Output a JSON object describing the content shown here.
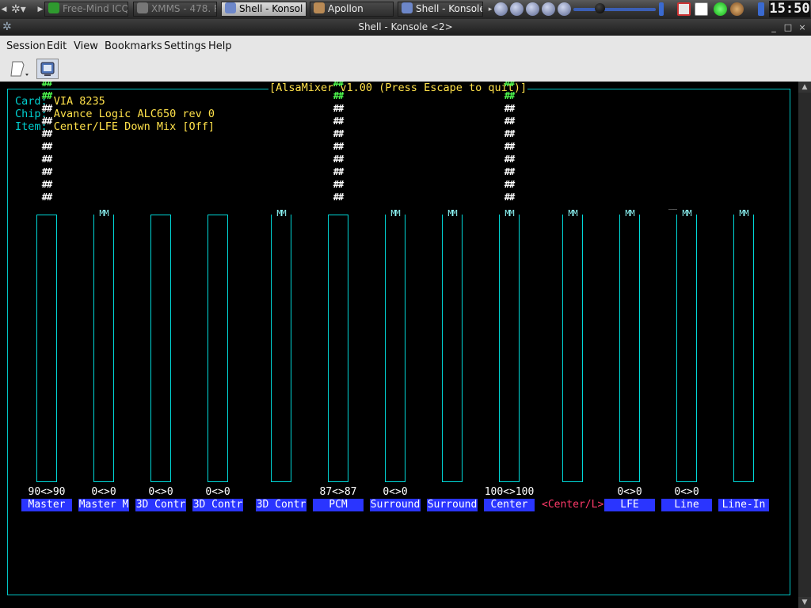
{
  "taskbar": {
    "tasks": [
      {
        "label": "Free-Mind ICQ",
        "icon": "flower-icon"
      },
      {
        "label": "XMMS - 478. R",
        "icon": "headphones-icon"
      },
      {
        "label": "Shell - Konsol",
        "icon": "star-icon"
      },
      {
        "label": "Apollon",
        "icon": "apollon-icon"
      },
      {
        "label": "Shell - Konsole",
        "icon": "star-icon"
      }
    ],
    "clock": "15:50"
  },
  "window": {
    "title": "Shell - Konsole <2>",
    "buttons": {
      "minimize": "_",
      "maximize": "□",
      "close": "×"
    }
  },
  "menubar": [
    "Session",
    "Edit",
    "View",
    "Bookmarks",
    "Settings",
    "Help"
  ],
  "terminal": {
    "frame_title": "[AlsaMixer v1.00 (Press Escape to quit)]",
    "info": [
      {
        "key": "Card:",
        "value": "VIA 8235"
      },
      {
        "key": "Chip:",
        "value": "Avance Logic ALC650 rev 0"
      },
      {
        "key": "Item:",
        "value": "Center/LFE Down Mix [Off]"
      }
    ],
    "cap_line": "______",
    "mm_label": "MM",
    "controls": [
      {
        "name": "Master",
        "value": "90<>90",
        "level": 18,
        "red": 2,
        "green": 8,
        "muted": false,
        "selected": false
      },
      {
        "name": "Master M",
        "value": "0<>0",
        "level": 0,
        "red": 0,
        "green": 0,
        "muted": true,
        "selected": false
      },
      {
        "name": "3D Contr",
        "value": "0<>0",
        "level": 0,
        "red": 0,
        "green": 0,
        "muted": false,
        "selected": false
      },
      {
        "name": "3D Contr",
        "value": "0<>0",
        "level": 0,
        "red": 0,
        "green": 0,
        "muted": false,
        "selected": false
      },
      {
        "name": "3D Contr",
        "value": "",
        "level": 0,
        "red": 0,
        "green": 0,
        "muted": true,
        "selected": false
      },
      {
        "name": "PCM",
        "value": "87<>87",
        "level": 18,
        "red": 2,
        "green": 8,
        "muted": false,
        "selected": false
      },
      {
        "name": "Surround",
        "value": "0<>0",
        "level": 0,
        "red": 0,
        "green": 0,
        "muted": true,
        "selected": false
      },
      {
        "name": "Surround",
        "value": "",
        "level": 0,
        "red": 0,
        "green": 0,
        "muted": true,
        "selected": false
      },
      {
        "name": "Center",
        "value": "100<>100",
        "level": 20,
        "red": 4,
        "green": 8,
        "muted": true,
        "selected": false
      },
      {
        "name": "<Center/L>",
        "value": "",
        "level": 0,
        "red": 0,
        "green": 0,
        "muted": true,
        "selected": true
      },
      {
        "name": "LFE",
        "value": "0<>0",
        "level": 0,
        "red": 0,
        "green": 0,
        "muted": true,
        "selected": false
      },
      {
        "name": "Line",
        "value": "0<>0",
        "level": 0,
        "red": 0,
        "green": 0,
        "muted": true,
        "selected": false
      },
      {
        "name": "Line-In",
        "value": "",
        "level": 0,
        "red": 0,
        "green": 0,
        "muted": true,
        "selected": false
      }
    ]
  }
}
